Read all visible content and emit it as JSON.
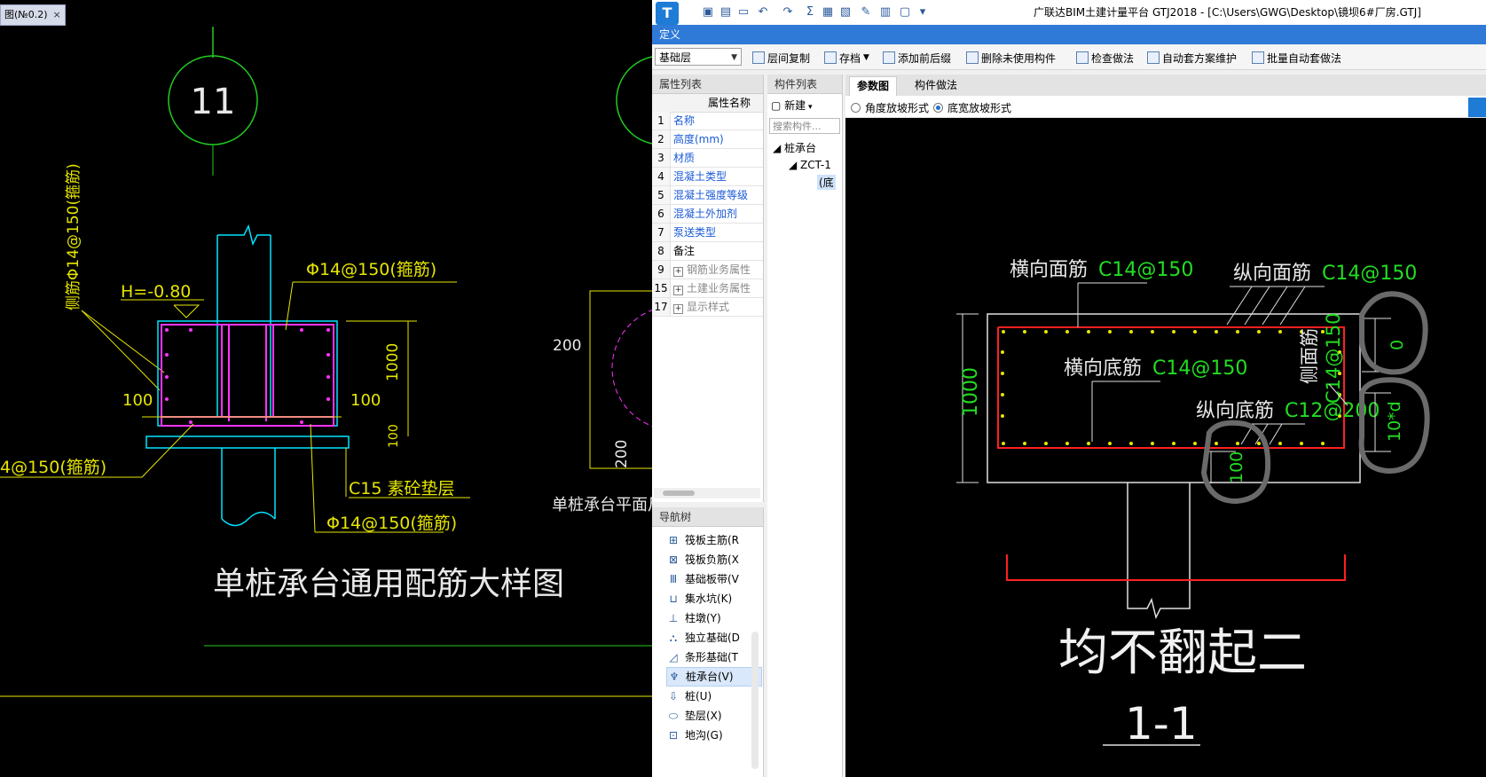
{
  "cad": {
    "tab_label": "图(№0.2)",
    "tab_close": "×",
    "axis_label": "11",
    "title": "单桩承台通用配筋大样图",
    "elev": "H=-0.80",
    "side_bar": "侧筋Φ14@150(箍筋)",
    "top_bar": "Φ14@150(箍筋)",
    "left_dim": "100",
    "right_dim": "100",
    "height_dim": "1000",
    "pad_dim": "100",
    "bottom_bar_left": "4@150(箍筋)",
    "cushion": "C15 素砼垫层",
    "bottom_bar": "Φ14@150(箍筋)",
    "plan_dim_top": "200",
    "plan_dim_bottom": "200",
    "plan_title": "单桩承台平面尺寸"
  },
  "app": {
    "title": "广联达BIM土建计量平台 GTJ2018 - [C:\\Users\\GWG\\Desktop\\镜坝6#厂房.GTJ]",
    "logo": "T",
    "definition_bar": "定义",
    "floor_select": "基础层",
    "toolbar": [
      {
        "label": "层间复制"
      },
      {
        "label": "存档"
      },
      {
        "label": "添加前后缀"
      },
      {
        "label": "删除未使用构件"
      },
      {
        "label": "检查做法"
      },
      {
        "label": "自动套方案维护"
      },
      {
        "label": "批量自动套做法"
      }
    ],
    "attr_panel_title": "属性列表",
    "attr_col_header": "属性名称",
    "attributes": [
      {
        "num": "1",
        "name": "名称"
      },
      {
        "num": "2",
        "name": "高度(mm)"
      },
      {
        "num": "3",
        "name": "材质"
      },
      {
        "num": "4",
        "name": "混凝土类型"
      },
      {
        "num": "5",
        "name": "混凝土强度等级"
      },
      {
        "num": "6",
        "name": "混凝土外加剂"
      },
      {
        "num": "7",
        "name": "泵送类型"
      },
      {
        "num": "8",
        "name": "备注"
      },
      {
        "num": "9",
        "name": "钢筋业务属性"
      },
      {
        "num": "15",
        "name": "土建业务属性"
      },
      {
        "num": "17",
        "name": "显示样式"
      }
    ],
    "nav_title": "导航树",
    "nav_items": [
      {
        "label": "筏板主筋(R"
      },
      {
        "label": "筏板负筋(X"
      },
      {
        "label": "基础板带(V"
      },
      {
        "label": "集水坑(K)"
      },
      {
        "label": "柱墩(Y)"
      },
      {
        "label": "独立基础(D"
      },
      {
        "label": "条形基础(T"
      },
      {
        "label": "桩承台(V)"
      },
      {
        "label": "桩(U)"
      },
      {
        "label": "垫层(X)"
      },
      {
        "label": "地沟(G)"
      }
    ],
    "comp_panel_title": "构件列表",
    "comp_new": "新建",
    "comp_search_placeholder": "搜索构件...",
    "tree_root": "桩承台",
    "tree_child": "ZCT-1",
    "tree_leaf": "(底",
    "view_tabs": [
      "参数图",
      "构件做法"
    ],
    "radio_options": [
      "角度放坡形式",
      "底宽放坡形式"
    ],
    "radio_selected": "底宽放坡形式"
  },
  "drawing": {
    "top_transverse": "横向面筋",
    "top_transverse_val": "C14@150",
    "top_longitudinal": "纵向面筋",
    "top_longitudinal_val": "C14@150",
    "bottom_transverse": "横向底筋",
    "bottom_transverse_val": "C14@150",
    "bottom_longitudinal": "纵向底筋",
    "bottom_longitudinal_val": "C12@200",
    "side_bar_label": "侧面筋",
    "side_bar_val": "C14@150",
    "height": "1000",
    "cover_top": "0",
    "anchor": "10*d",
    "cover_bottom": "100",
    "note": "均不翻起二",
    "section": "1-1"
  },
  "colors": {
    "cad_yellow": "#e6e600",
    "cad_magenta": "#ff33ff",
    "cad_cyan": "#00e5ff",
    "cad_green": "#22cc22",
    "rebar_red": "#ff2020",
    "dim_green": "#22dd22",
    "accent_blue": "#2f7ad7"
  }
}
